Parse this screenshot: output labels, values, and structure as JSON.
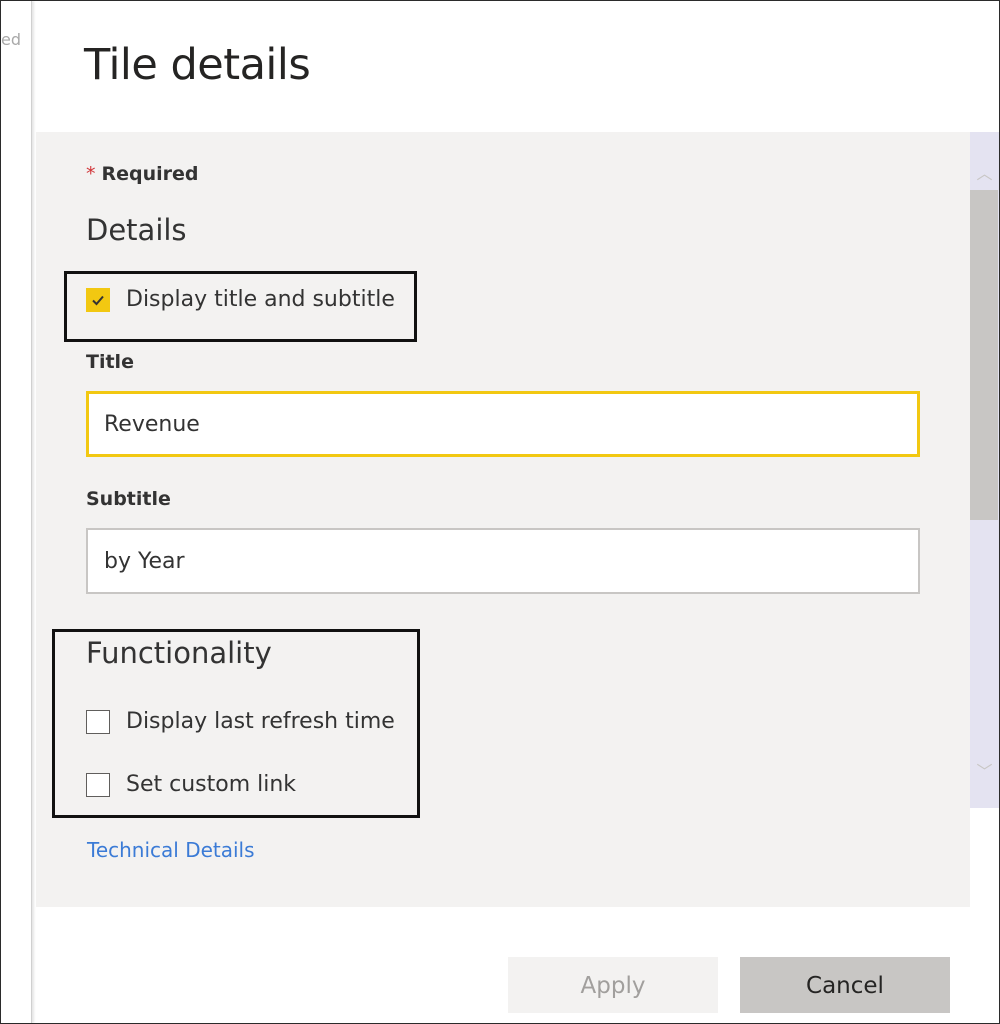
{
  "background_text": "ed",
  "dialog": {
    "title": "Tile details",
    "required_marker": "*",
    "required_label": "Required",
    "details": {
      "heading": "Details",
      "display_title_checkbox": {
        "label": "Display title and subtitle",
        "checked": true
      },
      "title_field": {
        "label": "Title",
        "value": "Revenue"
      },
      "subtitle_field": {
        "label": "Subtitle",
        "value": "by Year"
      }
    },
    "functionality": {
      "heading": "Functionality",
      "refresh_checkbox": {
        "label": "Display last refresh time",
        "checked": false
      },
      "custom_link_checkbox": {
        "label": "Set custom link",
        "checked": false
      }
    },
    "technical_details_link": "Technical Details",
    "buttons": {
      "apply": "Apply",
      "cancel": "Cancel"
    }
  },
  "colors": {
    "accent": "#f2c811",
    "link": "#3b7bd6",
    "required_star": "#d13438",
    "content_bg": "#f3f2f1"
  }
}
